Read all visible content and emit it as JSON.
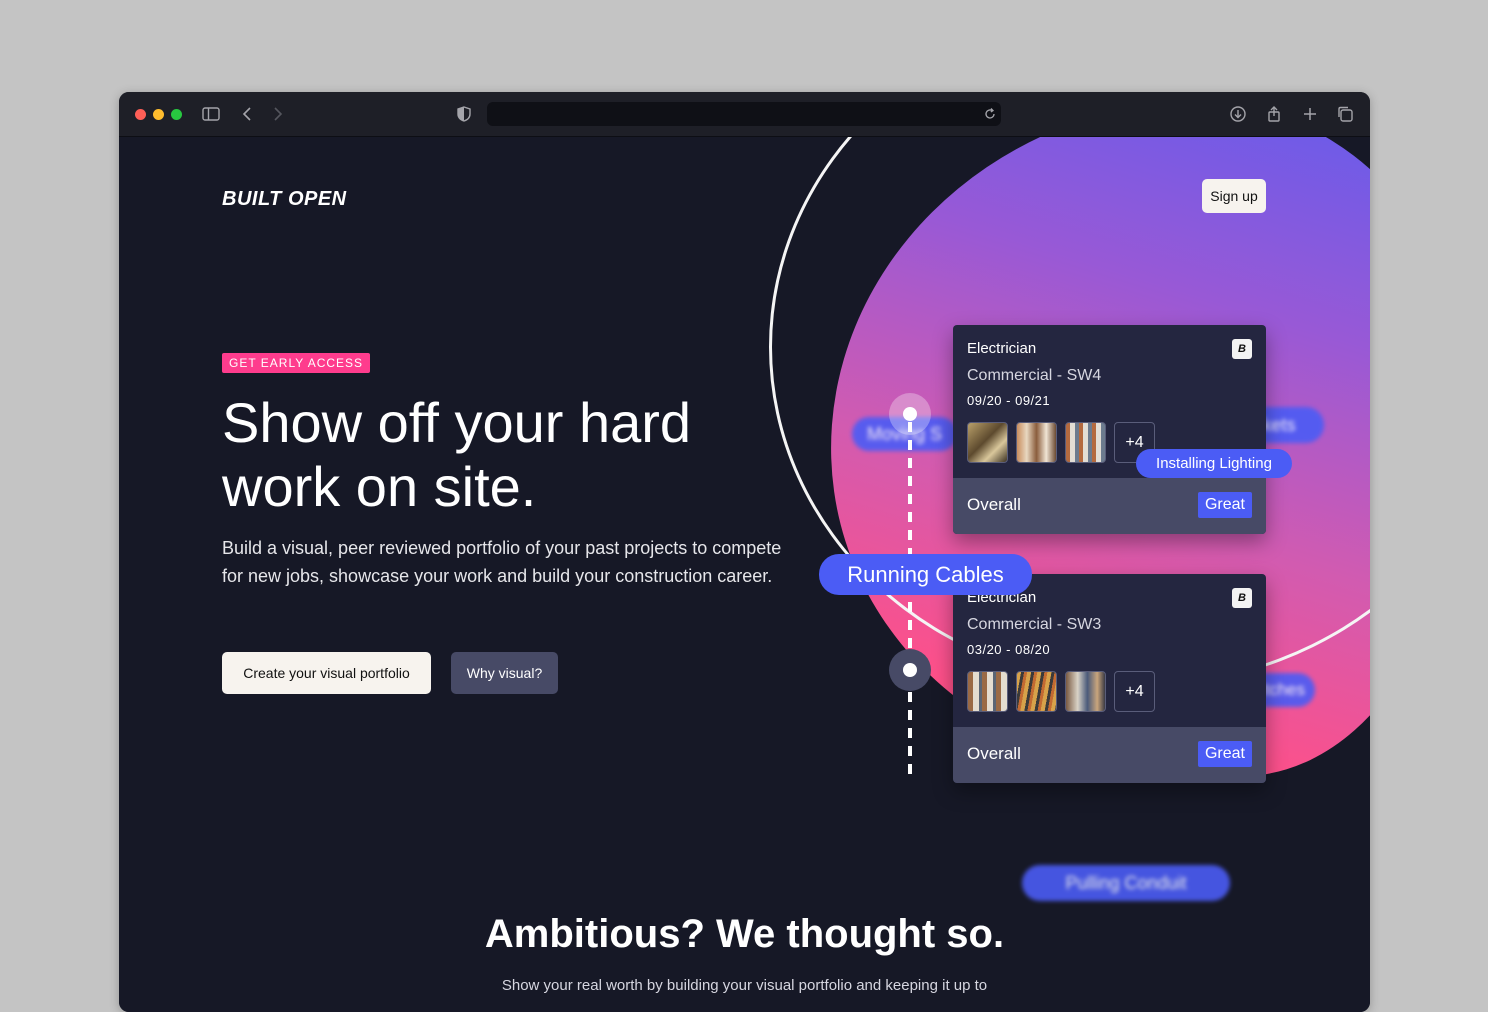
{
  "browser": {
    "url": ""
  },
  "header": {
    "logo": "BUILT OPEN",
    "signup_label": "Sign up"
  },
  "hero": {
    "badge": "GET EARLY ACCESS",
    "headline": "Show off your hard work on site.",
    "subtext": "Build a visual, peer reviewed portfolio of your past projects to compete for new jobs, showcase your work and build your construction career.",
    "primary_cta": "Create your visual portfolio",
    "secondary_cta": "Why visual?"
  },
  "task_pills": {
    "moving": "Moving S",
    "sockets": "Fitting Sockets",
    "installing": "Installing Lighting",
    "running": "Running Cables",
    "switches": "Switches",
    "pulling": "Pulling Conduit"
  },
  "cards": [
    {
      "role": "Electrician",
      "location": "Commercial - SW4",
      "dates": "09/20 - 09/21",
      "brand": "B",
      "more": "+4",
      "overall_label": "Overall",
      "rating": "Great"
    },
    {
      "role": "Electrician",
      "location": "Commercial - SW3",
      "dates": "03/20 - 08/20",
      "brand": "B",
      "more": "+4",
      "overall_label": "Overall",
      "rating": "Great"
    }
  ],
  "section2": {
    "title": "Ambitious? We thought so.",
    "subtitle": "Show your real worth by building your visual portfolio and keeping it up to"
  },
  "colors": {
    "background": "#161826",
    "accent_pink": "#fe3c8d",
    "accent_blue": "#4b5cf5",
    "card": "#242640",
    "card_footer": "#474a66"
  }
}
